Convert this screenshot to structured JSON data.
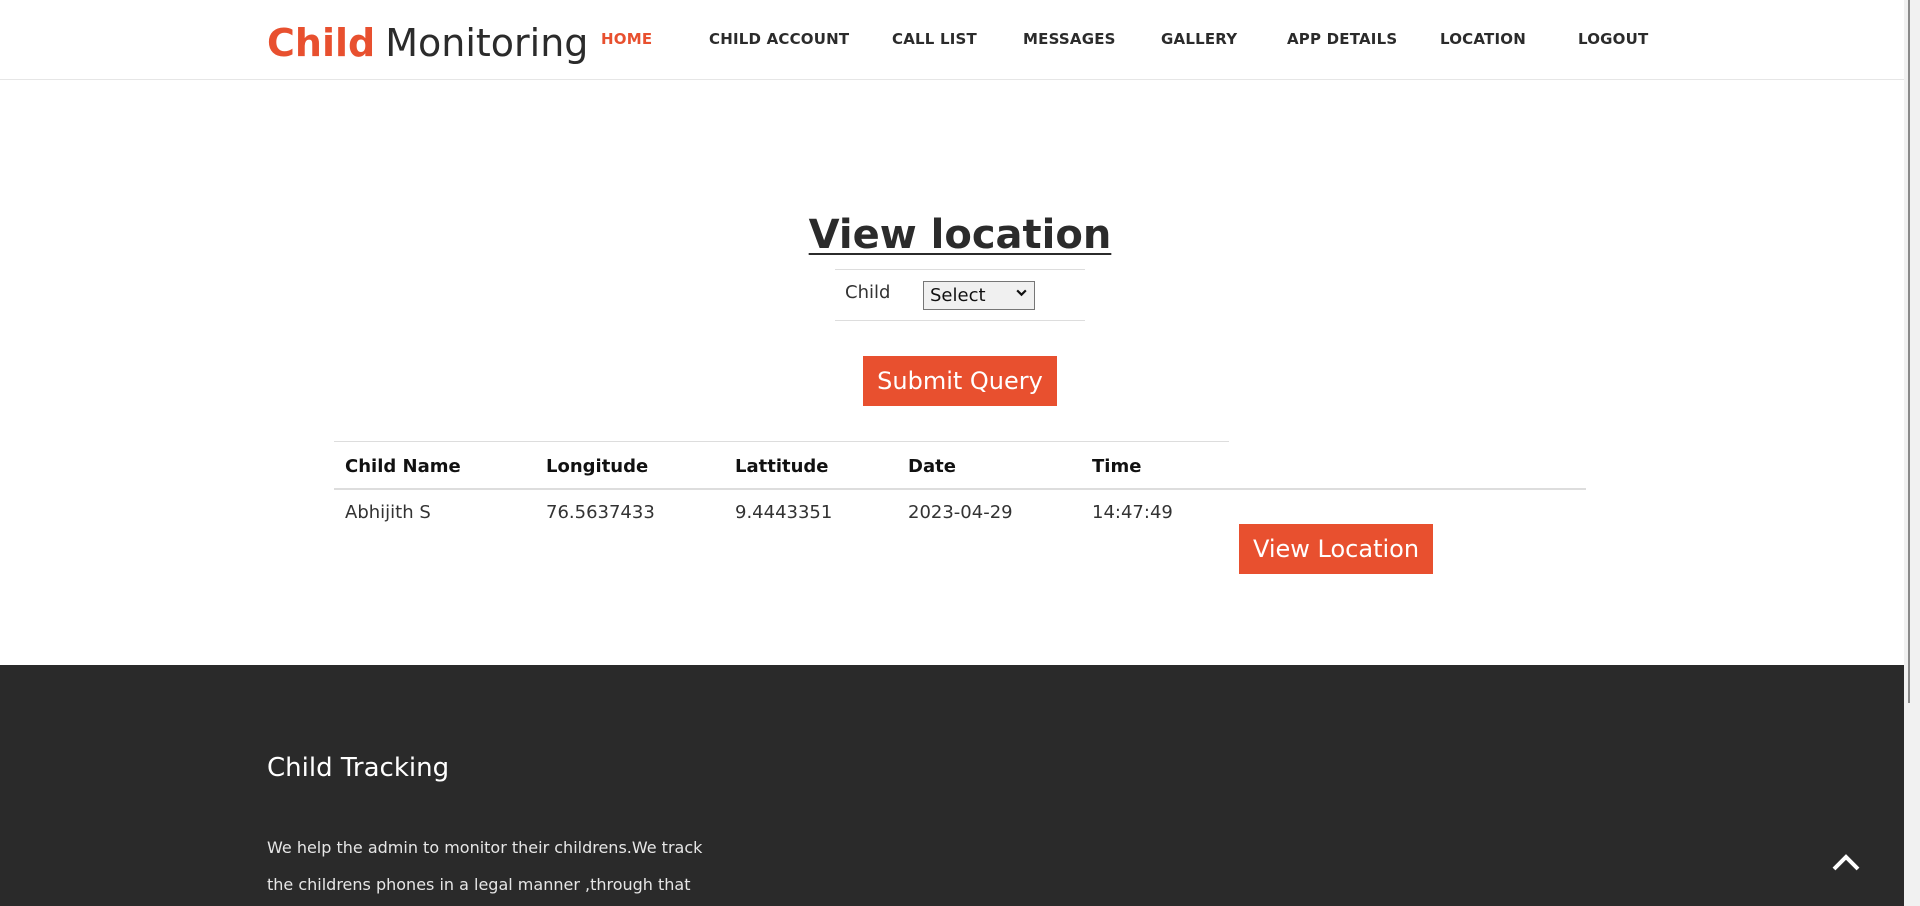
{
  "brand": {
    "accent": "Child",
    "rest": "Monitoring"
  },
  "nav": {
    "items": [
      {
        "label": "HOME",
        "active": true
      },
      {
        "label": "CHILD ACCOUNT",
        "active": false
      },
      {
        "label": "CALL LIST",
        "active": false
      },
      {
        "label": "MESSAGES",
        "active": false
      },
      {
        "label": "GALLERY",
        "active": false
      },
      {
        "label": "APP DETAILS",
        "active": false
      },
      {
        "label": "LOCATION",
        "active": false
      },
      {
        "label": "LOGOUT",
        "active": false
      }
    ]
  },
  "main": {
    "title": "View location",
    "form": {
      "child_label": "Child",
      "child_select_value": "Select",
      "submit_label": "Submit Query"
    },
    "table": {
      "headers": [
        "Child Name",
        "Longitude",
        "Lattitude",
        "Date",
        "Time"
      ],
      "rows": [
        {
          "child_name": "Abhijith S",
          "longitude": "76.5637433",
          "lattitude": "9.4443351",
          "date": "2023-04-29",
          "time": "14:47:49",
          "action_label": "View Location"
        }
      ]
    }
  },
  "footer": {
    "title": "Child Tracking",
    "text": "We help the admin to monitor their childrens.We track the childrens phones in a legal manner ,through that admin can"
  },
  "icons": {
    "back_to_top": "chevron-up-icon",
    "select_arrow": "chevron-down-icon"
  },
  "colors": {
    "accent": "#e8502f",
    "footer_bg": "#2a2a2a",
    "text": "#2b2b2b"
  }
}
